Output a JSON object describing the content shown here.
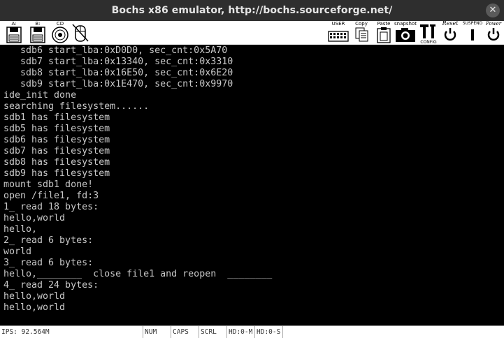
{
  "window": {
    "title": "Bochs x86 emulator, http://bochs.sourceforge.net/",
    "close_glyph": "✕"
  },
  "toolbar": {
    "floppy_a": "A:",
    "floppy_b": "B:",
    "cdrom": "CD",
    "user": "USER",
    "copy": "Copy",
    "paste": "Paste",
    "snapshot": "snapshot",
    "config": "CONFIG",
    "reset": "Reset",
    "suspend": "SUSPEND",
    "power": "Power"
  },
  "console": {
    "lines": [
      "   sdb6 start_lba:0xD0D0, sec_cnt:0x5A70",
      "   sdb7 start_lba:0x13340, sec_cnt:0x3310",
      "   sdb8 start_lba:0x16E50, sec_cnt:0x6E20",
      "   sdb9 start_lba:0x1E470, sec_cnt:0x9970",
      "ide_init done",
      "searching filesystem......",
      "sdb1 has filesystem",
      "sdb5 has filesystem",
      "sdb6 has filesystem",
      "sdb7 has filesystem",
      "sdb8 has filesystem",
      "sdb9 has filesystem",
      "mount sdb1 done!",
      "open /file1, fd:3",
      "1_ read 18 bytes:",
      "hello,world",
      "hello,",
      "2_ read 6 bytes:",
      "world",
      "3_ read 6 bytes:",
      "hello,________  close file1 and reopen  ________",
      "4_ read 24 bytes:",
      "hello,world",
      "hello,world"
    ]
  },
  "status": {
    "ips": "IPS: 92.564M",
    "num": "NUM",
    "caps": "CAPS",
    "scrl": "SCRL",
    "hd0m": "HD:0-M",
    "hd0s": "HD:0-S"
  },
  "colors": {
    "titlebar": "#2e2e2e",
    "console_bg": "#000000",
    "console_fg": "#c8c8c8"
  }
}
